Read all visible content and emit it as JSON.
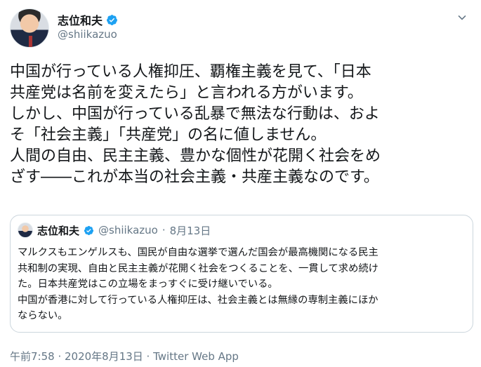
{
  "author": {
    "display_name": "志位和夫",
    "handle": "@shiikazuo",
    "verified": true
  },
  "tweet": {
    "lines": [
      "中国が行っている人権抑圧、覇権主義を見て、「日本",
      "共産党は名前を変えたら」と言われる方がいます。",
      "しかし、中国が行っている乱暴で無法な行動は、およ",
      "そ「社会主義」「共産党」の名に値しません。",
      "人間の自由、民主主義、豊かな個性が花開く社会をめ",
      "ざす――これが本当の社会主義・共産主義なのです。"
    ]
  },
  "quoted_tweet": {
    "display_name": "志位和夫",
    "handle": "@shiikazuo",
    "separator": "·",
    "date": "8月13日",
    "lines": [
      "マルクスもエンゲルスも、国民が自由な選挙で選んだ国会が最高機関になる民主",
      "共和制の実現、自由と民主主義が花開く社会をつくることを、一貫して求め続け",
      "た。日本共産党はこの立場をまっすぐに受け継いでいる。",
      "中国が香港に対して行っている人権抑圧は、社会主義とは無縁の専制主義にほか",
      "ならない。"
    ]
  },
  "meta": {
    "text": "午前7:58 · 2020年8月13日 · Twitter Web App"
  },
  "colors": {
    "text": "#14171a",
    "secondary": "#657786",
    "verified_blue": "#1da1f2",
    "border": "#ccd6dd"
  },
  "icons": {
    "verified": "verified-badge-icon",
    "more": "chevron-down-icon"
  }
}
